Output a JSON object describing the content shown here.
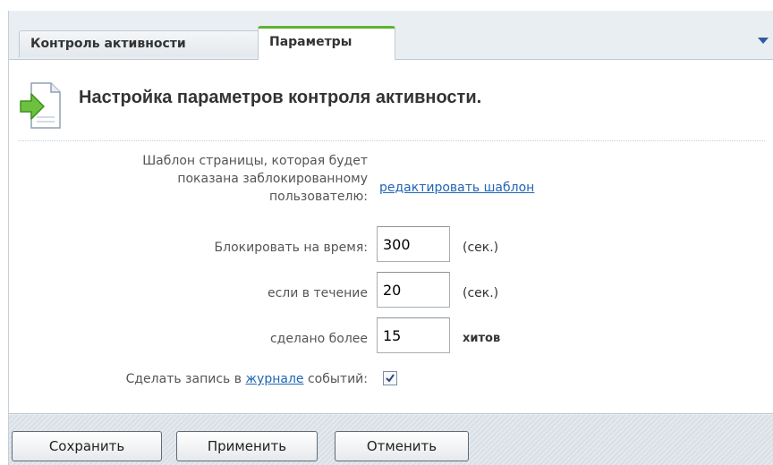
{
  "tabs": [
    {
      "label": "Контроль активности",
      "active": false
    },
    {
      "label": "Параметры",
      "active": true
    }
  ],
  "header": {
    "title": "Настройка параметров контроля активности.",
    "icon": "document-arrow-icon"
  },
  "form": {
    "template_label": [
      "Шаблон страницы, которая будет",
      "показана заблокированному",
      "пользователю:"
    ],
    "template_link": "редактировать шаблон",
    "block_time_label": "Блокировать на время:",
    "block_time_value": "300",
    "block_time_unit": "(сек.)",
    "period_label": "если в течение",
    "period_value": "20",
    "period_unit": "(сек.)",
    "hits_label": "сделано более",
    "hits_value": "15",
    "hits_unit": "хитов",
    "journal_prefix": "Сделать запись в",
    "journal_link": "журнале",
    "journal_suffix": "событий:",
    "journal_checked": true
  },
  "buttons": {
    "save": "Сохранить",
    "apply": "Применить",
    "cancel": "Отменить"
  },
  "colors": {
    "active_tab_accent": "#5fb234",
    "link": "#2066b5",
    "panel_bg": "#e9eef3"
  }
}
